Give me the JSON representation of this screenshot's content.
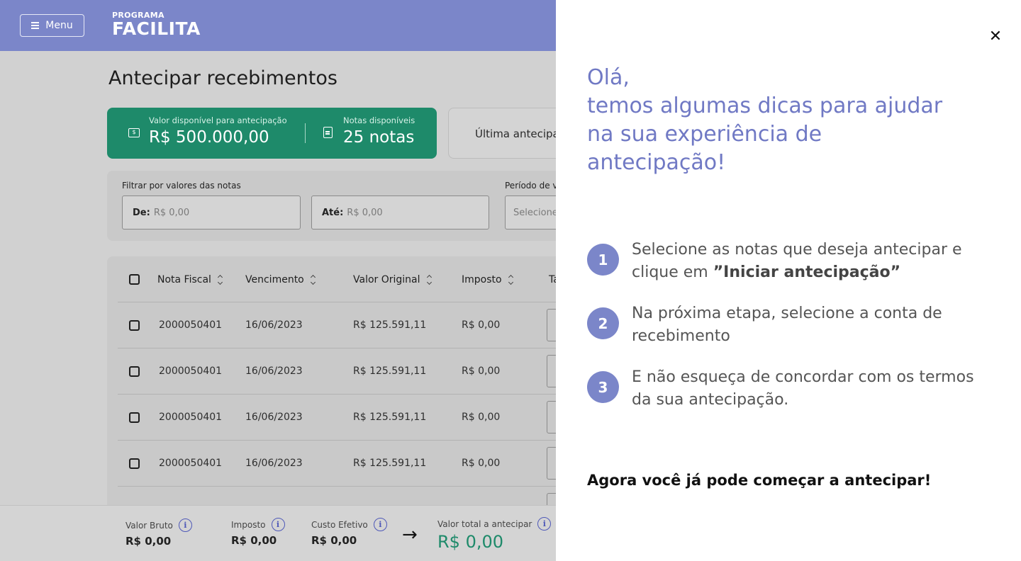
{
  "header": {
    "menu_label": "Menu",
    "brand_top": "PROGRAMA",
    "brand_main": "FACILITA"
  },
  "page": {
    "title": "Antecipar recebimentos",
    "available_value_label": "Valor disponível para antecipação",
    "available_value": "R$ 500.000,00",
    "available_notes_label": "Notas disponíveis",
    "available_notes": "25 notas",
    "last_card_text": "Última antecipação"
  },
  "filters": {
    "values_label": "Filtrar por valores das notas",
    "from_label": "De:",
    "from_placeholder": "R$ 0,00",
    "to_label": "Até:",
    "to_placeholder": "R$ 0,00",
    "period_label": "Período de vencimento",
    "period_placeholder": "Selecione"
  },
  "table": {
    "headers": [
      "Nota Fiscal",
      "Vencimento",
      "Valor Original",
      "Imposto",
      "Taxa"
    ],
    "rows": [
      {
        "nota": "2000050401",
        "vencimento": "16/06/2023",
        "valor": "R$ 125.591,11",
        "imposto": "R$ 0,00"
      },
      {
        "nota": "2000050401",
        "vencimento": "16/06/2023",
        "valor": "R$ 125.591,11",
        "imposto": "R$ 0,00"
      },
      {
        "nota": "2000050401",
        "vencimento": "16/06/2023",
        "valor": "R$ 125.591,11",
        "imposto": "R$ 0,00"
      },
      {
        "nota": "2000050401",
        "vencimento": "16/06/2023",
        "valor": "R$ 125.591,11",
        "imposto": "R$ 0,00"
      }
    ]
  },
  "footer": {
    "bruto_label": "Valor Bruto",
    "bruto_value": "R$ 0,00",
    "imposto_label": "Imposto",
    "imposto_value": "R$ 0,00",
    "custo_label": "Custo Efetivo",
    "custo_value": "R$ 0,00",
    "total_label": "Valor total a antecipar",
    "total_value": "R$ 0,00",
    "info_glyph": "i",
    "arrow_glyph": "→"
  },
  "drawer": {
    "close_glyph": "✕",
    "greeting": "Olá,\ntemos algumas dicas para ajudar\nna sua experiência de\nantecipação!",
    "steps": [
      {
        "num": "1",
        "text_before": "Selecione as notas que deseja antecipar e clique em ",
        "text_bold": "”Iniciar antecipação”"
      },
      {
        "num": "2",
        "text_before": "Na próxima etapa, selecione a conta de recebimento",
        "text_bold": ""
      },
      {
        "num": "3",
        "text_before": "E não esqueça de concordar com os termos da sua antecipação.",
        "text_bold": ""
      }
    ],
    "closing": "Agora você já pode começar a antecipar!"
  },
  "colors": {
    "header": "#7b86c9",
    "green_card": "#1e8a6a",
    "accent_text": "#7079c4",
    "total_value": "#1e8a6a"
  }
}
